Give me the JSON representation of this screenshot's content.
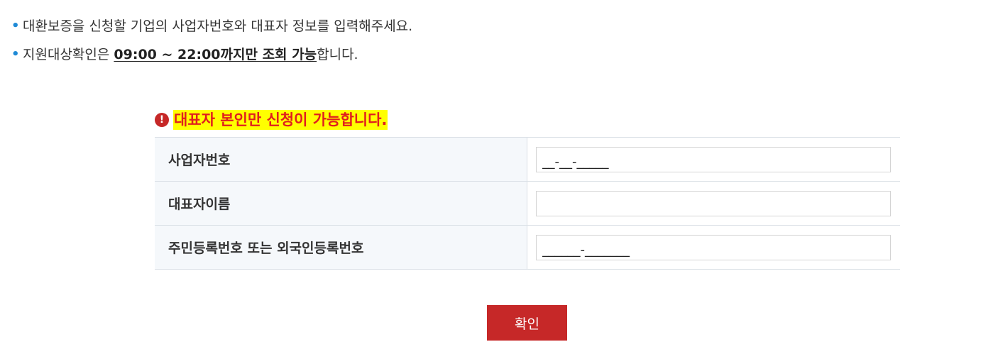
{
  "notes": {
    "line1": "대환보증을 신청할 기업의 사업자번호와 대표자 정보를 입력해주세요.",
    "line2_prefix": "지원대상확인은 ",
    "line2_emphasis": "09:00 ~ 22:00까지만 조회 가능",
    "line2_suffix": "합니다."
  },
  "warning": {
    "icon": "exclamation-icon",
    "text": "대표자 본인만 신청이 가능합니다.",
    "color": "#e01e1e",
    "highlight": "#ffff00"
  },
  "form": {
    "business_number": {
      "label": "사업자번호",
      "value": "__-__-_____"
    },
    "representative_name": {
      "label": "대표자이름",
      "value": ""
    },
    "resident_number": {
      "label": "주민등록번호 또는 외국인등록번호",
      "value": "______-_______"
    }
  },
  "buttons": {
    "confirm_label": "확인",
    "confirm_color": "#c62828"
  }
}
